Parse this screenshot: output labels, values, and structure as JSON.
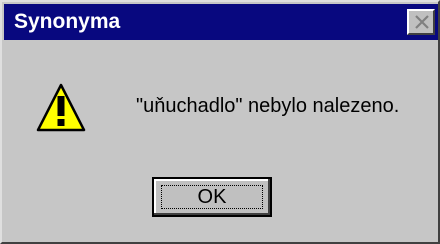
{
  "window": {
    "title": "Synonyma",
    "close_icon": "close-icon"
  },
  "content": {
    "icon": "warning-icon",
    "message": "\"uňuchadlo\" nebylo nalezeno."
  },
  "buttons": {
    "ok_label": "OK"
  },
  "colors": {
    "titlebar": "#08087f",
    "background": "#c6c6c6",
    "warning_fill": "#ffff00"
  }
}
